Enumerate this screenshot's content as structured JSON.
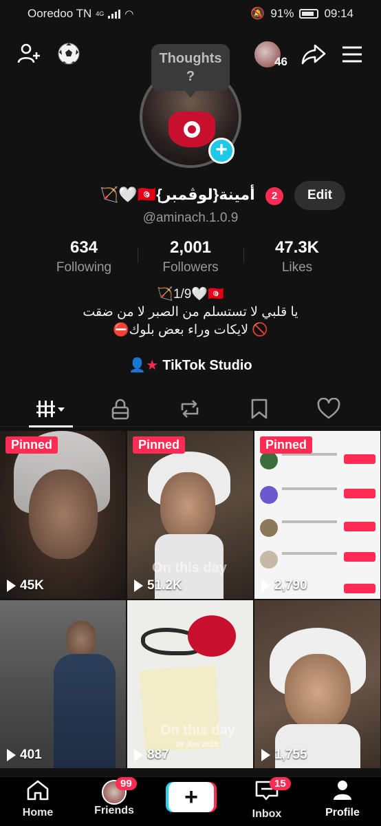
{
  "status": {
    "carrier": "Ooredoo TN",
    "network": "4G",
    "battery": "91%",
    "time": "09:14"
  },
  "thoughts": {
    "line1": "Thoughts",
    "line2": "?"
  },
  "story_count": "46",
  "profile": {
    "display_name": "🏹🤍🇹🇳{لوڤمبر}أمينة",
    "name_badge": "2",
    "handle": "@aminach.1.0.9",
    "edit_label": "Edit"
  },
  "stats": {
    "following": {
      "value": "634",
      "label": "Following"
    },
    "followers": {
      "value": "2,001",
      "label": "Followers"
    },
    "likes": {
      "value": "47.3K",
      "label": "Likes"
    }
  },
  "bio": {
    "line1": "🏹1/9🤍🇹🇳",
    "line2": "يا قلبي لا تستسلم من الصبر لا من ضقت",
    "line3": "⛔لايكات وراء بعض بلوك 🚫"
  },
  "studio_label": "TikTok Studio",
  "videos": [
    {
      "views": "45K",
      "pinned": "Pinned"
    },
    {
      "views": "51.2K",
      "pinned": "Pinned",
      "overlay": "On this day"
    },
    {
      "views": "2,790",
      "pinned": "Pinned"
    },
    {
      "views": "401"
    },
    {
      "views": "887",
      "overlay": "On this day",
      "overlay_date": "28 Jun 2025"
    },
    {
      "views": "1,755"
    }
  ],
  "bottom_nav": {
    "home": "Home",
    "friends": "Friends",
    "friends_badge": "99",
    "inbox": "Inbox",
    "inbox_badge": "15",
    "profile": "Profile"
  },
  "colors": {
    "accent_red": "#fe2c55",
    "accent_cyan": "#20d5ec",
    "background": "#121212"
  }
}
